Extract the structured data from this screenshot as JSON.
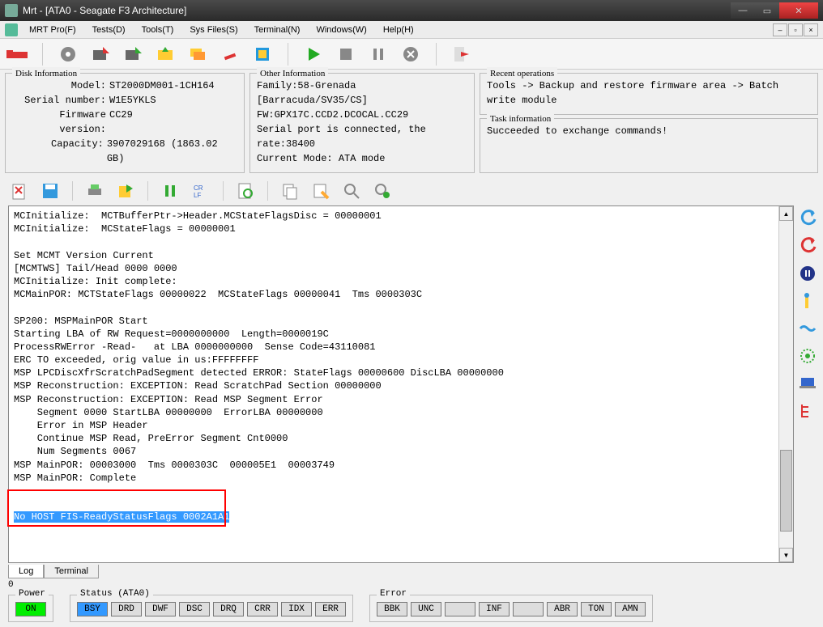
{
  "titlebar": {
    "title": "Mrt - [ATA0 - Seagate F3 Architecture]"
  },
  "menu": {
    "items": [
      "MRT Pro(F)",
      "Tests(D)",
      "Tools(T)",
      "Sys Files(S)",
      "Terminal(N)",
      "Windows(W)",
      "Help(H)"
    ]
  },
  "disk_info": {
    "legend": "Disk Information",
    "model_label": "Model:",
    "model": "ST2000DM001-1CH164",
    "serial_label": "Serial number:",
    "serial": "W1E5YKLS",
    "fw_label": "Firmware version:",
    "fw": "CC29",
    "cap_label": "Capacity:",
    "cap": "3907029168 (1863.02 GB)"
  },
  "other_info": {
    "legend": "Other Information",
    "family": "Family:58-Grenada [Barracuda/SV35/CS]",
    "fw": "FW:GPX17C.CCD2.DCOCAL.CC29",
    "serial": "Serial port is connected, the rate:38400",
    "mode": "Current Mode: ATA mode"
  },
  "recent": {
    "legend": "Recent operations",
    "text": "Tools -> Backup and restore firmware area -> Batch write module"
  },
  "task": {
    "legend": "Task information",
    "text": "Succeeded to exchange commands!"
  },
  "console": {
    "lines": [
      "MCInitialize:  MCTBufferPtr->Header.MCStateFlagsDisc = 00000001",
      "MCInitialize:  MCStateFlags = 00000001",
      "",
      "Set MCMT Version Current",
      "[MCMTWS] Tail/Head 0000 0000",
      "MCInitialize: Init complete:",
      "MCMainPOR: MCTStateFlags 00000022  MCStateFlags 00000041  Tms 0000303C",
      "",
      "SP200: MSPMainPOR Start",
      "Starting LBA of RW Request=0000000000  Length=0000019C",
      "ProcessRWError -Read-   at LBA 0000000000  Sense Code=43110081",
      "ERC TO exceeded, orig value in us:FFFFFFFF",
      "MSP LPCDiscXfrScratchPadSegment detected ERROR: StateFlags 00000600 DiscLBA 00000000",
      "MSP Reconstruction: EXCEPTION: Read ScratchPad Section 00000000",
      "MSP Reconstruction: EXCEPTION: Read MSP Segment Error",
      "    Segment 0000 StartLBA 00000000  ErrorLBA 00000000",
      "    Error in MSP Header",
      "    Continue MSP Read, PreError Segment Cnt0000",
      "    Num Segments 0067",
      "MSP MainPOR: 00003000  Tms 0000303C  000005E1  00003749",
      "MSP MainPOR: Complete",
      "",
      ""
    ],
    "highlighted": "No HOST FIS-ReadyStatusFlags 0002A1A1"
  },
  "tabs": {
    "log": "Log",
    "terminal": "Terminal"
  },
  "zero": "0",
  "status": {
    "power_legend": "Power",
    "power": "ON",
    "ata_legend": "Status (ATA0)",
    "ata": [
      "BSY",
      "DRD",
      "DWF",
      "DSC",
      "DRQ",
      "CRR",
      "IDX",
      "ERR"
    ],
    "err_legend": "Error",
    "err": [
      "BBK",
      "UNC",
      "",
      "INF",
      "",
      "ABR",
      "TON",
      "AMN"
    ]
  }
}
